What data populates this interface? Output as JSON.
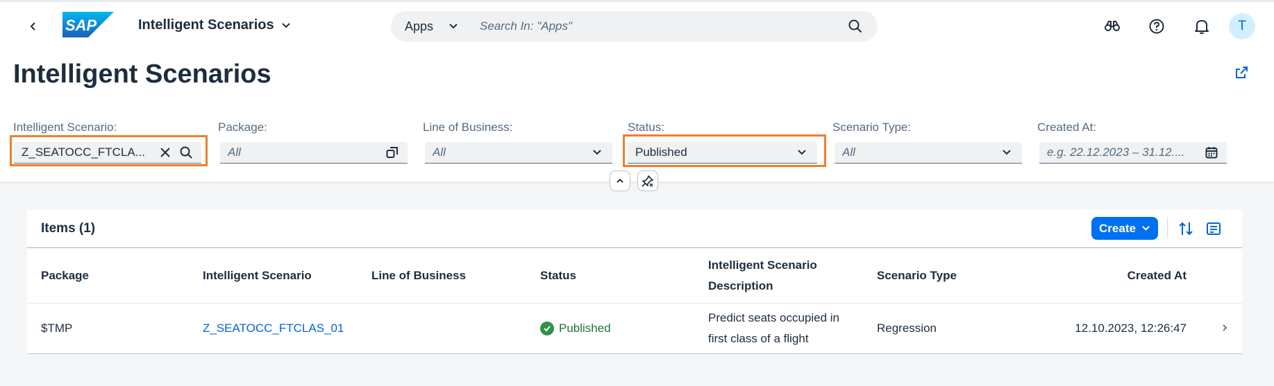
{
  "shell": {
    "app_title": "Intelligent Scenarios",
    "search_scope": "Apps",
    "search_placeholder": "Search In: \"Apps\"",
    "avatar_initial": "T"
  },
  "header": {
    "page_title": "Intelligent Scenarios"
  },
  "filters": {
    "intelligent_scenario": {
      "label": "Intelligent Scenario:",
      "value": "Z_SEATOCC_FTCLA..."
    },
    "package": {
      "label": "Package:",
      "placeholder": "All"
    },
    "line_of_business": {
      "label": "Line of Business:",
      "placeholder": "All"
    },
    "status": {
      "label": "Status:",
      "value": "Published"
    },
    "scenario_type": {
      "label": "Scenario Type:",
      "placeholder": "All"
    },
    "created_at": {
      "label": "Created At:",
      "placeholder": "e.g. 22.12.2023 – 31.12...."
    }
  },
  "table": {
    "title": "Items (1)",
    "create_label": "Create",
    "columns": [
      "Package",
      "Intelligent Scenario",
      "Line of Business",
      "Status",
      "Intelligent Scenario Description",
      "Scenario Type",
      "Created At"
    ],
    "rows": [
      {
        "package": "$TMP",
        "intelligent_scenario": "Z_SEATOCC_FTCLAS_01",
        "line_of_business": "",
        "status": "Published",
        "description": "Predict seats occupied in first class of a flight",
        "scenario_type": "Regression",
        "created_at": "12.10.2023, 12:26:47"
      }
    ]
  },
  "colors": {
    "accent": "#0070f2",
    "highlight": "#ee7f2c",
    "positive": "#30914c"
  }
}
